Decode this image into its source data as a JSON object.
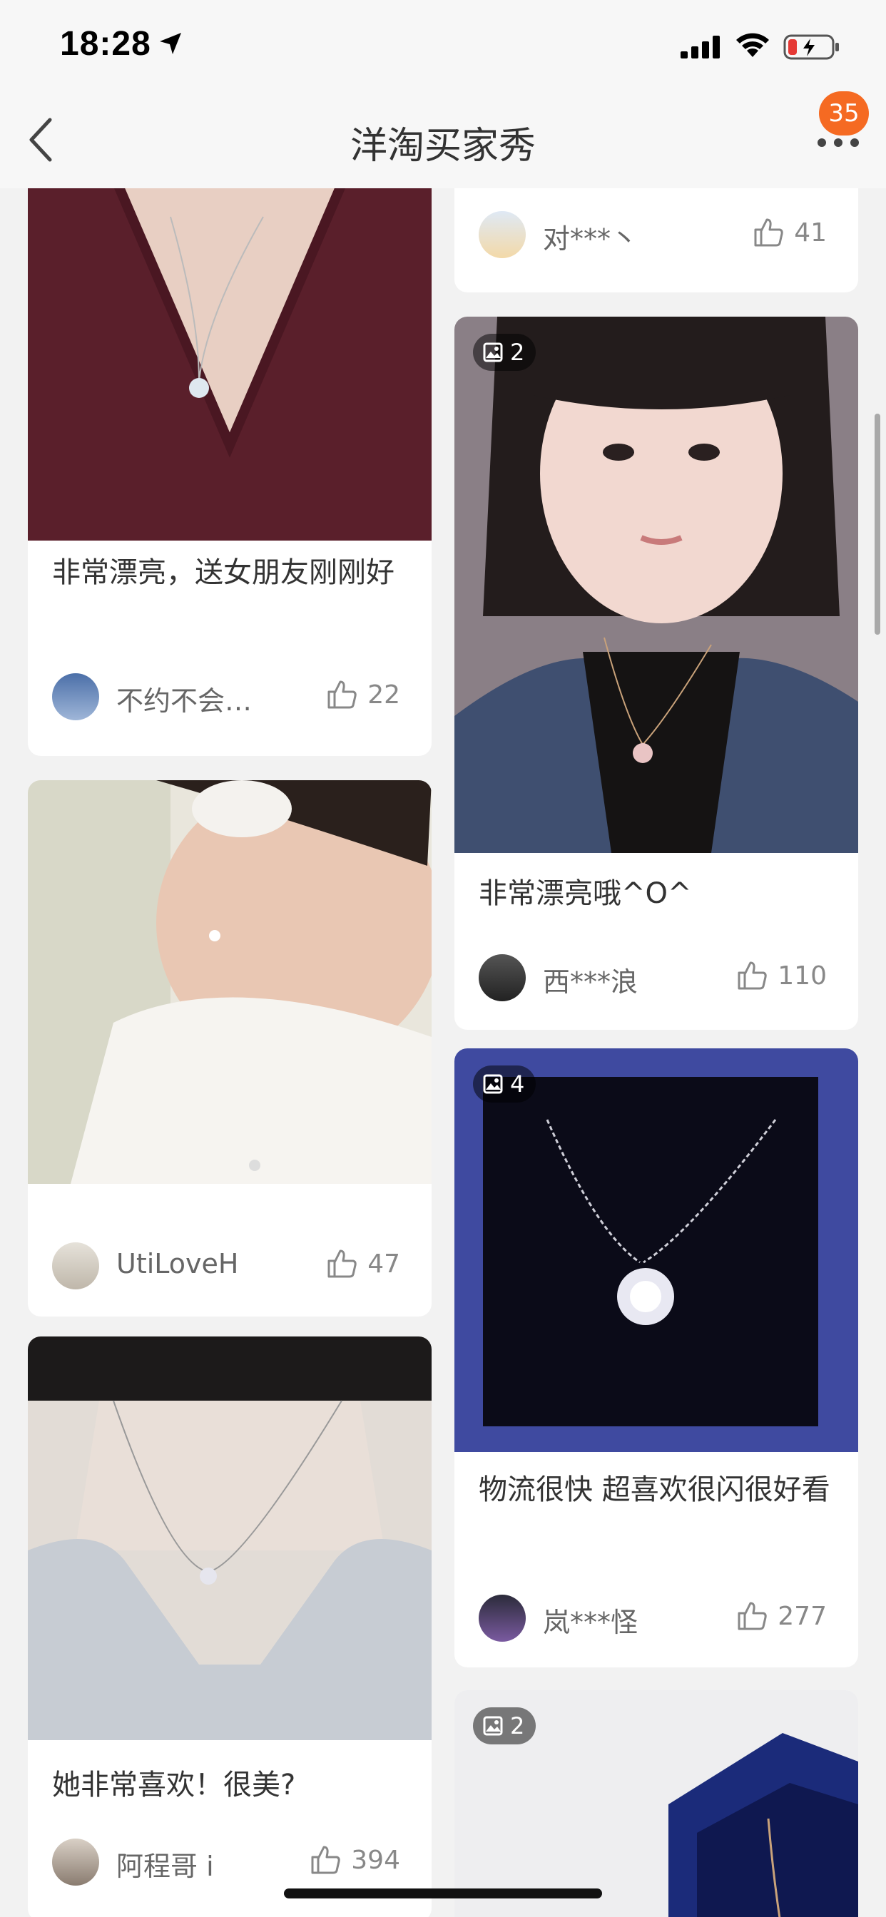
{
  "status": {
    "time": "18:28"
  },
  "nav": {
    "title": "洋淘买家秀",
    "badge": "35"
  },
  "feed": {
    "left": [
      {
        "caption": "非常漂亮，送女朋友刚刚好",
        "user": "不约不会…",
        "likes": "22"
      },
      {
        "caption": "",
        "user": "UtiLoveH",
        "likes": "47"
      },
      {
        "caption": "她非常喜欢！很美?",
        "user": "阿程哥 i",
        "likes": "394"
      }
    ],
    "right": [
      {
        "caption": "",
        "user": "对***丶",
        "likes": "41"
      },
      {
        "caption": "非常漂亮哦^O^",
        "user": "西***浪",
        "likes": "110",
        "image_count": "2"
      },
      {
        "caption": "物流很快 超喜欢很闪很好看",
        "user": "岚***怪",
        "likes": "277",
        "image_count": "4"
      },
      {
        "caption": "",
        "user": "",
        "likes": "",
        "image_count": "2"
      }
    ]
  },
  "icons": [
    "location-arrow-icon",
    "signal-icon",
    "wifi-icon",
    "battery-icon",
    "back-chevron-icon",
    "more-dots-icon",
    "thumbs-up-icon",
    "image-icon"
  ],
  "colors": {
    "accent": "#f56a22",
    "background": "#f2f2f2",
    "card": "#ffffff"
  }
}
